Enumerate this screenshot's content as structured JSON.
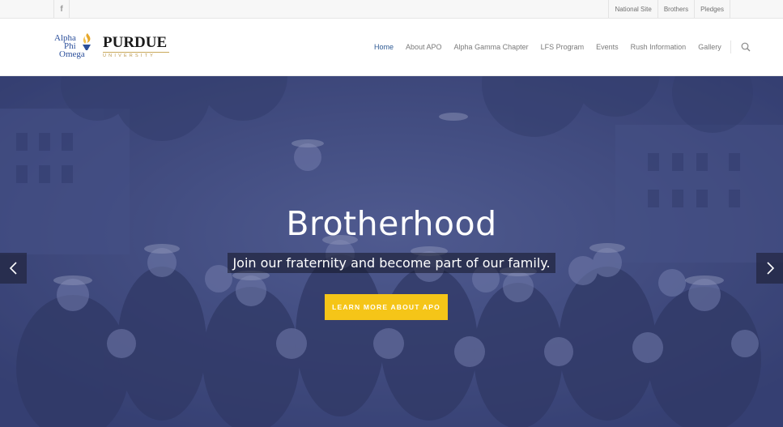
{
  "topbar": {
    "facebook_icon": "facebook-icon",
    "links": [
      "National Site",
      "Brothers",
      "Pledges"
    ]
  },
  "header": {
    "apo_logo": {
      "line1": "Alpha",
      "line2": "Phi",
      "line3": "Omega"
    },
    "purdue_logo": {
      "word": "PURDUE",
      "sub": "UNIVERSITY"
    },
    "nav": [
      "Home",
      "About APO",
      "Alpha Gamma Chapter",
      "LFS Program",
      "Events",
      "Rush Information",
      "Gallery"
    ],
    "active_nav": "Home",
    "search_icon": "search-icon"
  },
  "hero": {
    "title": "Brotherhood",
    "subtitle": "Join our fraternity and become part of our family.",
    "cta_label": "LEARN MORE ABOUT APO",
    "prev_icon": "chevron-left-icon",
    "next_icon": "chevron-right-icon"
  },
  "colors": {
    "nav_active": "#2e5a94",
    "cta": "#f5c518",
    "hero_overlay": "#3f4a7e"
  }
}
